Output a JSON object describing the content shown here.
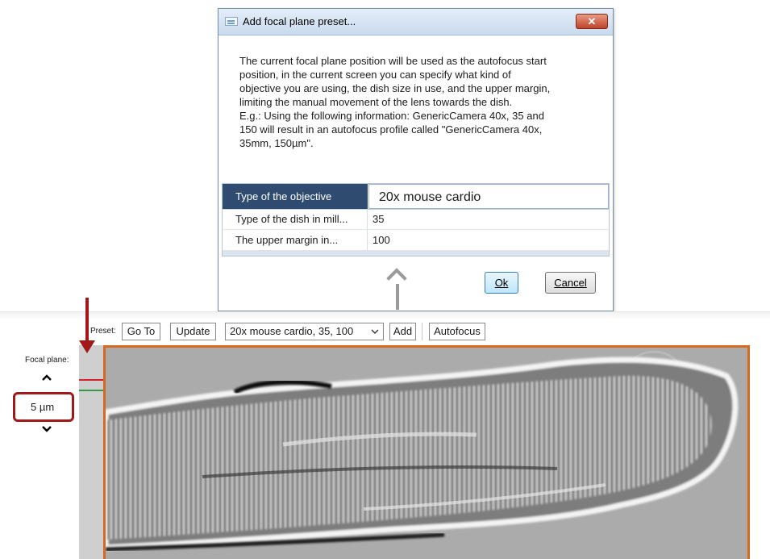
{
  "dialog": {
    "title": "Add focal plane preset...",
    "close_label": "✕",
    "description": [
      "The current focal plane position will be used as the autofocus start",
      "position, in the current screen you can specify what kind of",
      "objective you are using, the dish size in use, and the upper margin,",
      "limiting the manual movement of the lens towards the dish.",
      "E.g.: Using the following information: GenericCamera 40x, 35 and",
      "150 will result in an autofocus profile called \"GenericCamera 40x,",
      "35mm, 150µm\"."
    ],
    "properties": [
      {
        "label": "Type of the objective",
        "value": "20x mouse cardio"
      },
      {
        "label": "Type of the dish in mill...",
        "value": "35"
      },
      {
        "label": "The upper margin in...",
        "value": "100"
      }
    ],
    "ok_label": "Ok",
    "cancel_label": "Cancel"
  },
  "toolbar": {
    "preset_label": "Preset:",
    "goto_label": "Go To",
    "update_label": "Update",
    "preset_value": "20x mouse cardio, 35, 100",
    "add_label": "Add",
    "autofocus_label": "Autofocus"
  },
  "focal_plane": {
    "label": "Focal plane:",
    "value": "5 µm",
    "up_glyph": "⌃",
    "down_glyph": "⌄"
  },
  "colors": {
    "viewer_border": "#d46a20",
    "annotation_red": "#a01818",
    "dialog_header_selected": "#2f4c70"
  }
}
